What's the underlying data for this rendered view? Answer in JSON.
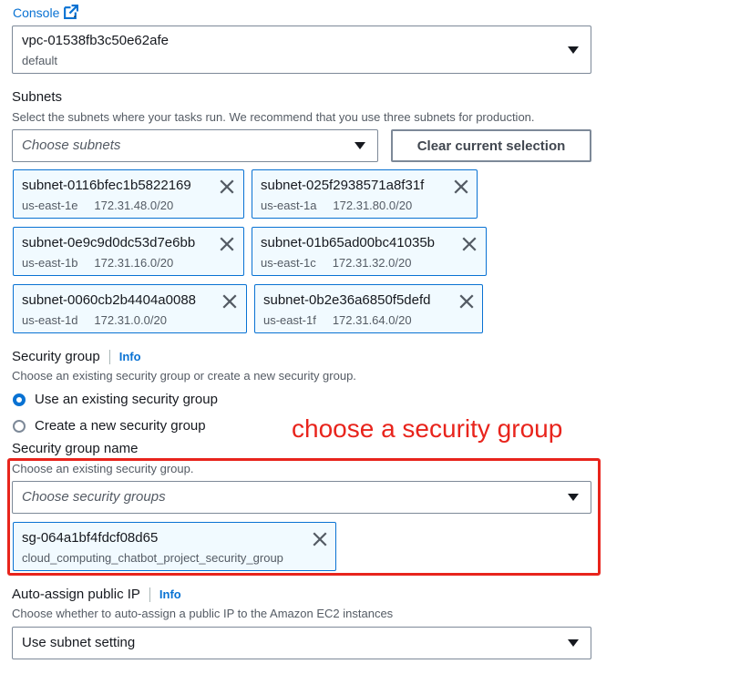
{
  "top": {
    "console_link": "Console",
    "trailing_text": "."
  },
  "vpc": {
    "id": "vpc-01538fb3c50e62afe",
    "subtitle": "default"
  },
  "subnets": {
    "label": "Subnets",
    "description": "Select the subnets where your tasks run. We recommend that you use three subnets for production.",
    "placeholder": "Choose subnets",
    "clear_button": "Clear current selection",
    "tokens": [
      {
        "id": "subnet-0116bfec1b5822169",
        "az": "us-east-1e",
        "cidr": "172.31.48.0/20"
      },
      {
        "id": "subnet-025f2938571a8f31f",
        "az": "us-east-1a",
        "cidr": "172.31.80.0/20"
      },
      {
        "id": "subnet-0e9c9d0dc53d7e6bb",
        "az": "us-east-1b",
        "cidr": "172.31.16.0/20"
      },
      {
        "id": "subnet-01b65ad00bc41035b",
        "az": "us-east-1c",
        "cidr": "172.31.32.0/20"
      },
      {
        "id": "subnet-0060cb2b4404a0088",
        "az": "us-east-1d",
        "cidr": "172.31.0.0/20"
      },
      {
        "id": "subnet-0b2e36a6850f5defd",
        "az": "us-east-1f",
        "cidr": "172.31.64.0/20"
      }
    ]
  },
  "security_group": {
    "label": "Security group",
    "info": "Info",
    "description": "Choose an existing security group or create a new security group.",
    "options": [
      {
        "label": "Use an existing security group",
        "selected": true
      },
      {
        "label": "Create a new security group",
        "selected": false
      }
    ],
    "name_label": "Security group name",
    "name_description": "Choose an existing security group.",
    "placeholder": "Choose security groups",
    "token": {
      "id": "sg-064a1bf4fdcf08d65",
      "name": "cloud_computing_chatbot_project_security_group"
    }
  },
  "annotation": {
    "text": "choose a security group",
    "color": "#e8241c"
  },
  "public_ip": {
    "label": "Auto-assign public IP",
    "info": "Info",
    "description": "Choose whether to auto-assign a public IP to the Amazon EC2 instances",
    "value": "Use subnet setting"
  },
  "colors": {
    "accent": "#0972d3",
    "token_bg": "#f1faff",
    "text": "#16191f",
    "secondary_text": "#545b64"
  }
}
